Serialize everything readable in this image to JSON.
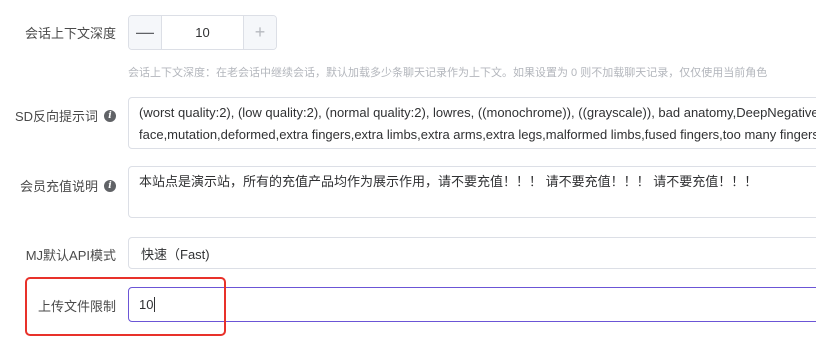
{
  "context_depth": {
    "label": "会话上下文深度",
    "value": "10",
    "hint": "会话上下文深度：在老会话中继续会话，默认加载多少条聊天记录作为上下文。如果设置为 0 则不加载聊天记录，仅仅使用当前角色"
  },
  "sd_negative_prompt": {
    "label": "SD反向提示词",
    "info_icon": "info-icon",
    "lines": [
      "(worst quality:2), (low quality:2), (normal quality:2), lowres, ((monochrome)), ((grayscale)), bad anatomy,DeepNegative, skin spots, acnes,",
      "face,mutation,deformed,extra fingers,extra limbs,extra arms,extra legs,malformed limbs,fused fingers,too many fingers,long neck,cross-eyed"
    ]
  },
  "member_recharge_note": {
    "label": "会员充值说明",
    "info_icon": "info-icon",
    "text": "本站点是演示站，所有的充值产品均作为展示作用，请不要充值！！！ 请不要充值！！！ 请不要充值！！！"
  },
  "mj_api_mode": {
    "label": "MJ默认API模式",
    "selected": "快速（Fast)"
  },
  "upload_limit": {
    "label": "上传文件限制",
    "value": "10"
  },
  "colors": {
    "focus_border": "#6b55d6",
    "highlight": "#e8312a"
  }
}
